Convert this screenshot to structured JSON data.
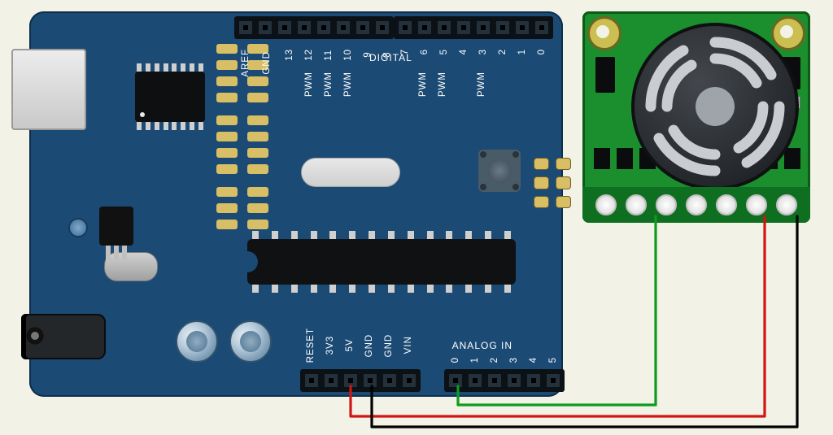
{
  "diagram": {
    "arduino": {
      "digital_header_section": "DIGITAL",
      "analog_header_section": "ANALOG IN",
      "top_pre_labels": [
        "AREF",
        "GND"
      ],
      "top_labels_a": [
        "13",
        "12",
        "11",
        "10",
        "9",
        "8"
      ],
      "top_labels_b": [
        "7",
        "6",
        "5",
        "4",
        "3",
        "2",
        "1",
        "0"
      ],
      "pwm_a": [
        "PWM",
        "PWM",
        "PWM"
      ],
      "pwm_b": [
        "PWM",
        "PWM",
        "PWM"
      ],
      "power_labels": [
        "RESET",
        "3V3",
        "5V",
        "GND",
        "GND",
        "VIN"
      ],
      "analog_labels": [
        "0",
        "1",
        "2",
        "3",
        "4",
        "5"
      ]
    },
    "sonar": {
      "pin_count": 7
    },
    "wires": [
      {
        "name": "5V → sonar Vcc",
        "color": "#d11515"
      },
      {
        "name": "GND → sonar GND",
        "color": "#000000"
      },
      {
        "name": "A0 → sonar AN",
        "color": "#0f9b1f"
      }
    ]
  }
}
